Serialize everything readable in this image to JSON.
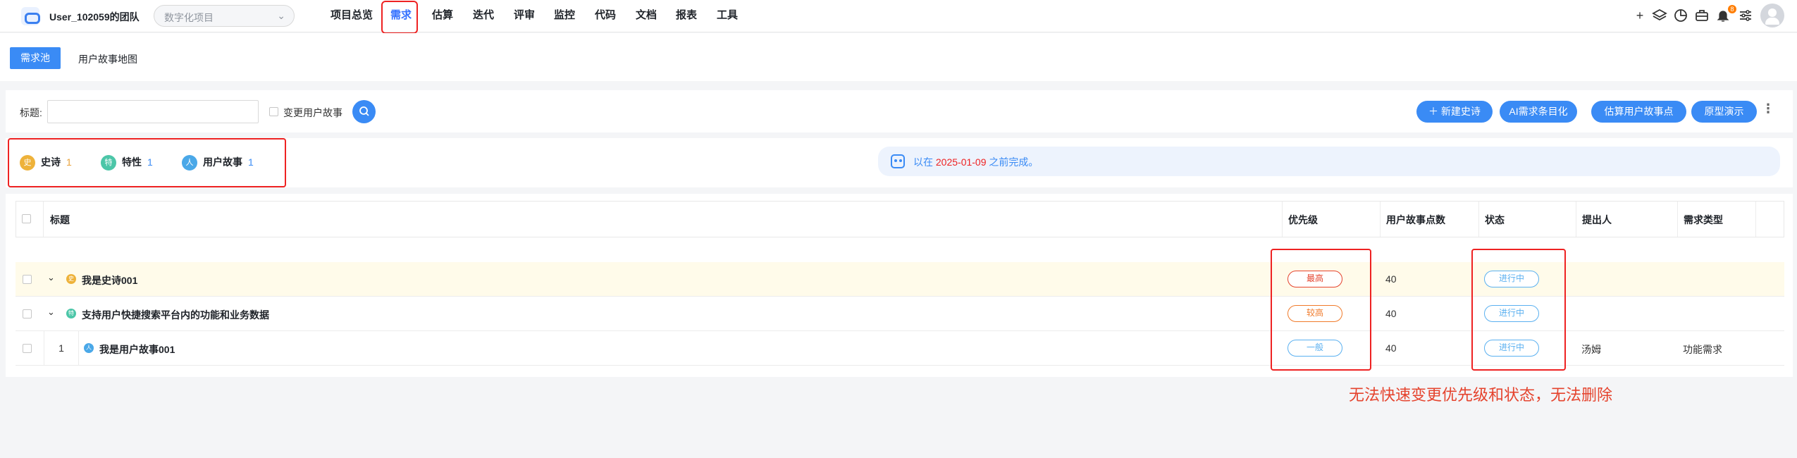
{
  "colors": {
    "accent": "#3a8bf5",
    "annotation": "#e22222"
  },
  "topbar": {
    "team": "User_102059的团队",
    "project_placeholder": "数字化项目",
    "nav": [
      "项目总览",
      "需求",
      "估算",
      "迭代",
      "评审",
      "监控",
      "代码",
      "文档",
      "报表",
      "工具"
    ],
    "active_nav": "需求",
    "icons": [
      "plus-icon",
      "layers-icon",
      "chart-pie-icon",
      "briefcase-icon",
      "bell-icon",
      "sliders-icon",
      "avatar"
    ],
    "bell_badge": "8"
  },
  "subnav": {
    "tab_active": "需求池",
    "tab2": "用户故事地图"
  },
  "filter": {
    "title_label": "标题:",
    "change_story_label": "变更用户故事",
    "buttons": [
      "＋ 新建史诗",
      "AI需求条目化",
      "估算用户故事点",
      "原型演示"
    ]
  },
  "stats": {
    "items": [
      {
        "icon": "史",
        "label": "史诗",
        "count": "1",
        "color": "#eeb23a"
      },
      {
        "icon": "特",
        "label": "特性",
        "count": "1",
        "color": "#4cc6a8"
      },
      {
        "icon": "人",
        "label": "用户故事",
        "count": "1",
        "color": "#4aa8e8"
      }
    ],
    "notice_pre": "以在",
    "notice_date": "2025-01-09",
    "notice_post": "之前完成。"
  },
  "table": {
    "headers": {
      "title": "标题",
      "priority": "优先级",
      "points": "用户故事点数",
      "status": "状态",
      "proposer": "提出人",
      "type": "需求类型"
    },
    "rows": [
      {
        "title": "我是史诗001",
        "priority": "最高",
        "points": "40",
        "status": "进行中",
        "proposer": "",
        "type": ""
      },
      {
        "title": "支持用户快捷搜索平台内的功能和业务数据",
        "priority": "较高",
        "points": "40",
        "status": "进行中",
        "proposer": "",
        "type": ""
      },
      {
        "num": "1",
        "title": "我是用户故事001",
        "priority": "一般",
        "points": "40",
        "status": "进行中",
        "proposer": "汤姆",
        "type": "功能需求"
      }
    ]
  },
  "annotation": "无法快速变更优先级和状态，无法删除"
}
